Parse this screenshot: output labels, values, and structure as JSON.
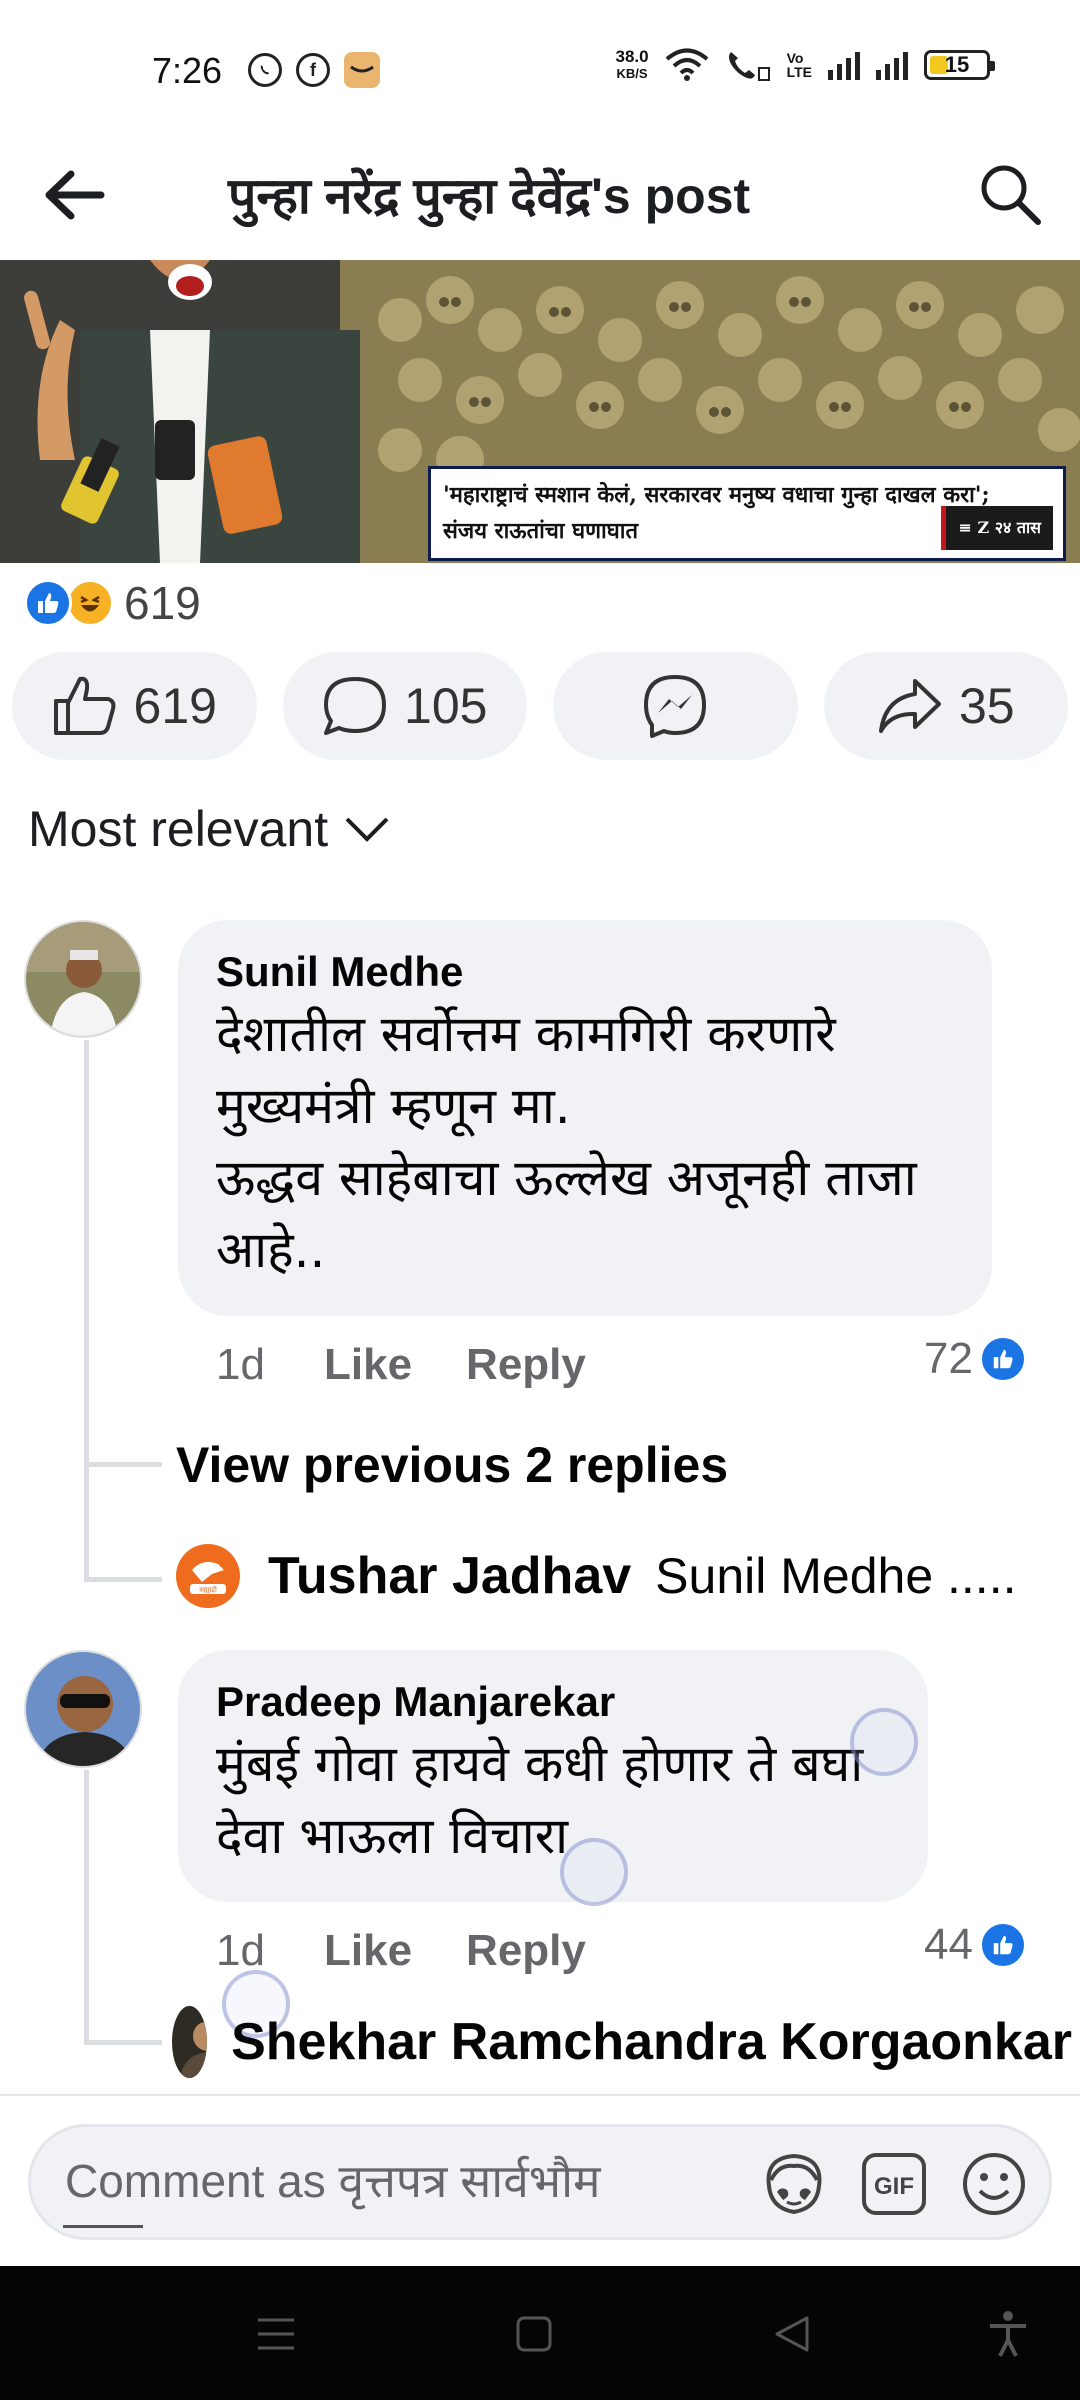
{
  "status_bar": {
    "time": "7:26",
    "net_speed_value": "38.0",
    "net_speed_unit": "KB/S",
    "volte_label_top": "Vo",
    "volte_label_bottom": "LTE",
    "battery": "15",
    "icons": [
      "whatsapp-icon",
      "facebook-icon",
      "amazon-icon",
      "wifi-icon",
      "wifi-call-icon",
      "signal-icon"
    ]
  },
  "header": {
    "title": "पुन्हा नरेंद्र पुन्हा देवेंद्र's post",
    "icons": [
      "back-arrow-icon",
      "search-icon"
    ]
  },
  "post_image": {
    "caption_line1": "'महाराष्ट्राचं स्मशान केलं, सरकारवर मनुष्य वधाचा गुन्हा दाखल करा';",
    "caption_line2": "संजय राऊतांचा घणाघात",
    "logo_text": "≡ Z २४ तास"
  },
  "reactions": {
    "count": "619",
    "types": [
      "like",
      "haha"
    ]
  },
  "actions": {
    "like_count": "619",
    "comment_count": "105",
    "share_count": "35"
  },
  "sort": {
    "label": "Most relevant"
  },
  "comments": [
    {
      "author": "Sunil Medhe",
      "text": "देशातील सर्वोत्तम कामगिरी करणारे\nमुख्यमंत्री म्हणून मा.\nऊद्धव साहेबाचा ऊल्लेख अजूनही ताजा\nआहे..",
      "time": "1d",
      "like_label": "Like",
      "reply_label": "Reply",
      "likes": "72",
      "view_previous": "View previous 2 replies",
      "reply_preview": {
        "name": "Tushar Jadhav",
        "text": "Sunil Medhe .....",
        "avatar_text": "सह्याद्री"
      }
    },
    {
      "author": "Pradeep Manjarekar",
      "text": "मुंबई गोवा हायवे कधी होणार ते बघा\nदेवा भाऊला विचारा",
      "time": "1d",
      "like_label": "Like",
      "reply_label": "Reply",
      "likes": "44",
      "reply_preview": {
        "name": "Shekhar Ramchandra Korgaonkar"
      }
    }
  ],
  "comment_bar": {
    "placeholder": "Comment as वृत्तपत्र सार्वभौम",
    "gif_label": "GIF",
    "icons": [
      "avatar-sticker-icon",
      "gif-icon",
      "emoji-icon"
    ]
  },
  "nav_bar": {
    "icons": [
      "menu-icon",
      "home-icon",
      "back-icon",
      "accessibility-icon"
    ]
  },
  "colors": {
    "facebook_blue": "#1b74e4",
    "pill_bg": "#f0f2f5",
    "secondary_text": "#65676b"
  }
}
